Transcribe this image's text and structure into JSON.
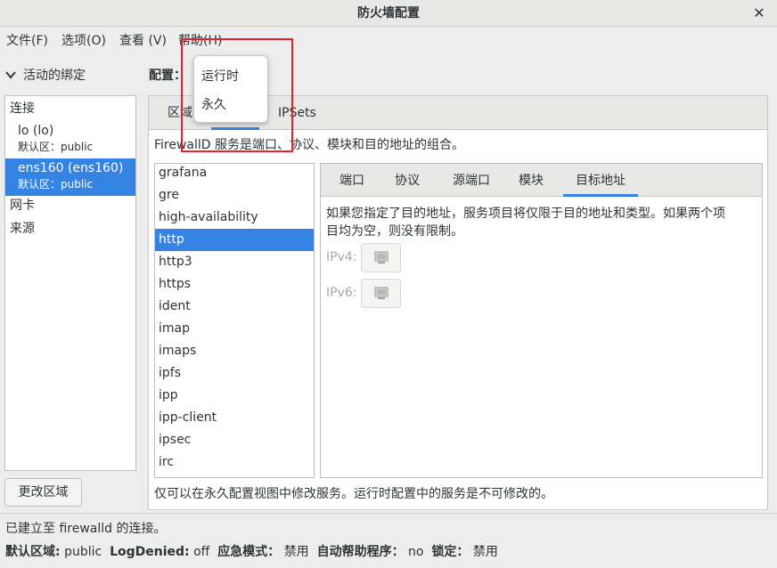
{
  "window": {
    "title": "防火墙配置",
    "close_icon": "close-icon"
  },
  "menu": [
    "文件(F)",
    "选项(O)",
    "查看 (V)",
    "帮助(H)"
  ],
  "left": {
    "header": "活动的绑定",
    "group_connections": "连接",
    "connections": [
      {
        "name": "lo (lo)",
        "zone": "默认区：public",
        "selected": false
      },
      {
        "name": "ens160 (ens160)",
        "zone": "默认区：public",
        "selected": true
      }
    ],
    "group_interfaces": "网卡",
    "group_sources": "来源",
    "change_zone_button": "更改区域"
  },
  "config": {
    "label": "配置："
  },
  "main_tabs": {
    "zones": "区域",
    "ipsets": "IPSets"
  },
  "popover": {
    "items": [
      "运行时",
      "永久"
    ]
  },
  "services": {
    "description": "FirewallD 服务是端口、协议、模块和目的地址的组合。",
    "list": [
      "grafana",
      "gre",
      "high-availability",
      "http",
      "http3",
      "https",
      "ident",
      "imap",
      "imaps",
      "ipfs",
      "ipp",
      "ipp-client",
      "ipsec",
      "irc"
    ],
    "selected": "http",
    "footer_note": "仅可以在永久配置视图中修改服务。运行时配置中的服务是不可修改的。"
  },
  "detail_tabs": [
    "端口",
    "协议",
    "源端口",
    "模块",
    "目标地址"
  ],
  "detail_active_tab": "目标地址",
  "destination": {
    "text_line1": "如果您指定了目的地址，服务项目将仅限于目的地址和类型。如果两个项",
    "text_line2": "目均为空，则没有限制。",
    "ipv4_label": "IPv4:",
    "ipv6_label": "IPv6:"
  },
  "status": {
    "line1": "已建立至 firewalld 的连接。",
    "default_zone_label": "默认区域:",
    "default_zone_value": "public",
    "logdenied_label": "LogDenied:",
    "logdenied_value": "off",
    "panic_label": "应急模式：",
    "panic_value": "禁用",
    "helper_label": "自动帮助程序：",
    "helper_value": "no",
    "lockdown_label": "锁定：",
    "lockdown_value": "禁用"
  },
  "colors": {
    "accent": "#3584e4",
    "highlight_box": "#e8202a"
  }
}
